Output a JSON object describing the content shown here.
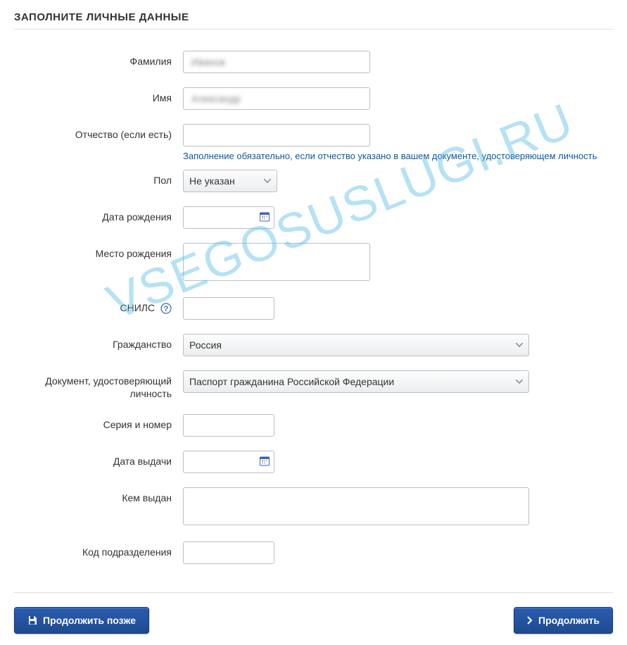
{
  "title": "ЗАПОЛНИТЕ ЛИЧНЫЕ ДАННЫЕ",
  "watermark": "VSEGOSUSLUGI.RU",
  "labels": {
    "surname": "Фамилия",
    "name": "Имя",
    "patronymic": "Отчество (если есть)",
    "gender": "Пол",
    "dob": "Дата рождения",
    "pob": "Место рождения",
    "snils": "СНИЛС",
    "citizenship": "Гражданство",
    "idDoc": "Документ, удостоверяющий личность",
    "seriesNumber": "Серия и номер",
    "issueDate": "Дата выдачи",
    "issuedBy": "Кем выдан",
    "deptCode": "Код подразделения"
  },
  "values": {
    "surname": "Иванов",
    "name": "Александр",
    "patronymic": "",
    "gender": "Не указан",
    "dob": "",
    "pob": "",
    "snils": "",
    "citizenship": "Россия",
    "idDoc": "Паспорт гражданина Российской Федерации",
    "seriesNumber": "",
    "issueDate": "",
    "issuedBy": "",
    "deptCode": ""
  },
  "hints": {
    "patronymic": "Заполнение обязательно, если отчество указано в вашем документе, удостоверяющем личность"
  },
  "buttons": {
    "saveLater": "Продолжить позже",
    "continue": "Продолжить"
  }
}
